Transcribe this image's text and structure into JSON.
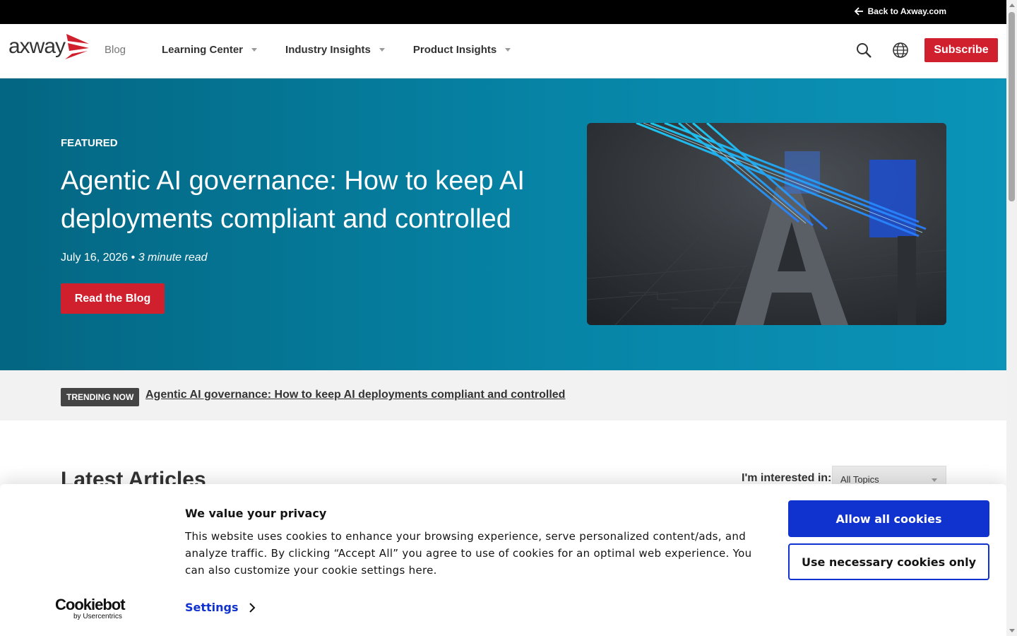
{
  "topbar": {
    "back_label": "Back to Axway.com"
  },
  "header": {
    "logo_text": "axway",
    "blog_label": "Blog",
    "nav": [
      {
        "label": "Learning Center"
      },
      {
        "label": "Industry Insights"
      },
      {
        "label": "Product Insights"
      }
    ],
    "subscribe_label": "Subscribe"
  },
  "hero": {
    "eyebrow": "FEATURED",
    "title": "Agentic AI governance: How to keep AI deployments compliant and controlled",
    "date": "July 16, 2026",
    "separator": " • ",
    "read_time": "3 minute read",
    "cta_label": "Read the Blog"
  },
  "trending": {
    "badge": "TRENDING NOW",
    "link": "Agentic AI governance: How to keep AI deployments compliant and controlled"
  },
  "latest": {
    "title": "Latest Articles",
    "interest_label": "I'm interested in:",
    "topic_selected": "All Topics"
  },
  "cookie": {
    "brand": "Cookiebot",
    "brand_sub": "by Usercentrics",
    "title": "We value your privacy",
    "text": "This website uses cookies to enhance your browsing experience, serve personalized content/ads, and analyze traffic. By clicking “Accept All” you agree to use of cookies for an optimal web experience. You can also customize your cookie settings here.",
    "settings_label": "Settings",
    "allow_all": "Allow all cookies",
    "necessary_only": "Use necessary cookies only"
  },
  "colors": {
    "brand_red": "#d0202e",
    "hero_teal": "#0784a6",
    "cookie_blue": "#1032cf"
  }
}
